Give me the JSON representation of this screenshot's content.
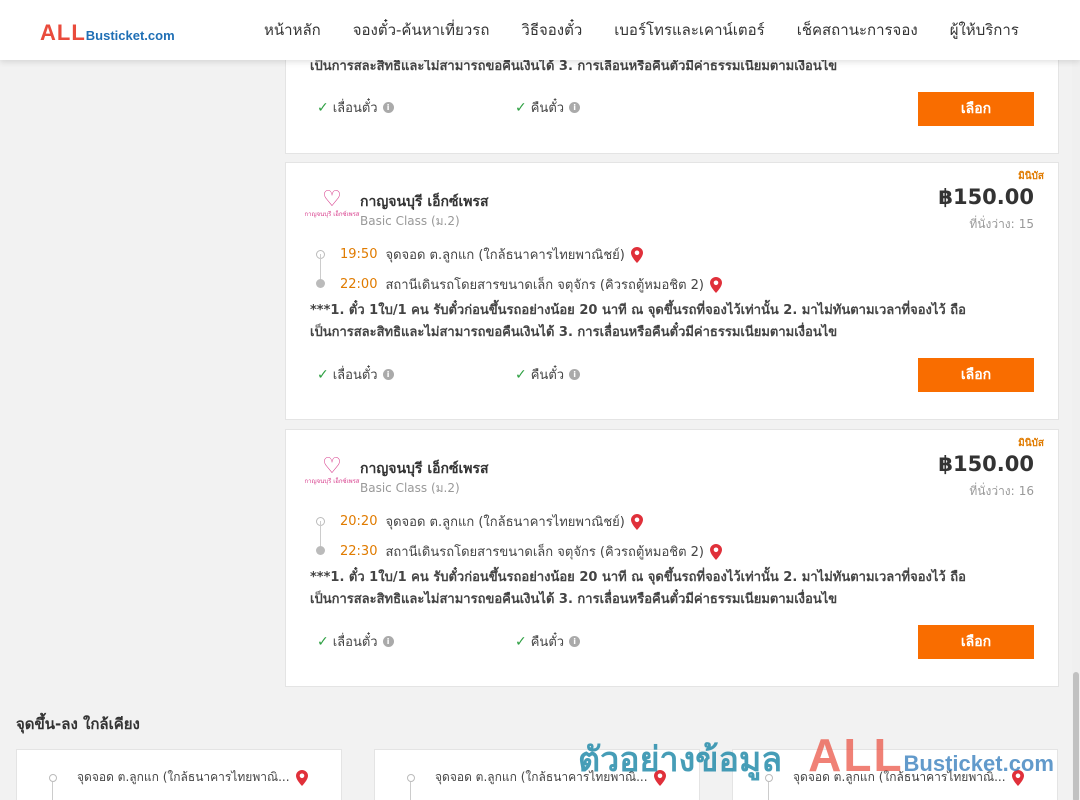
{
  "logo": {
    "all": "ALL",
    "rest": "Busticket.com"
  },
  "nav": [
    "หน้าหลัก",
    "จองตั๋ว-ค้นหาเที่ยวรถ",
    "วิธีจองตั๋ว",
    "เบอร์โทรและเคาน์เตอร์",
    "เช็คสถานะการจอง",
    "ผู้ให้บริการ"
  ],
  "top_card": {
    "condition_line2": "เป็นการสละสิทธิและไม่สามารถขอคืนเงินได้ 3. การเลื่อนหรือคืนตั๋วมีค่าธรรมเนียมตามเงื่อนไข",
    "change_label": "เลื่อนตั๋ว",
    "refund_label": "คืนตั๋ว",
    "select_label": "เลือก"
  },
  "trips": [
    {
      "badge": "มินิบัส",
      "logo_text": "กาญจนบุรี เอ็กซ์เพรส",
      "operator": "กาญจนบุรี เอ็กซ์เพรส",
      "class": "Basic Class (ม.2)",
      "price": "฿150.00",
      "seats_label": "ที่นั่งว่าง:",
      "seats": "15",
      "depart_time": "19:50",
      "depart_place": "จุดจอด ต.ลูกแก (ใกล้ธนาคารไทยพาณิชย์)",
      "arrive_time": "22:00",
      "arrive_place": "สถานีเดินรถโดยสารขนาดเล็ก จตุจักร (คิวรถตู้หมอชิต 2)",
      "condition_line1": "***1. ตั๋ว 1ใบ/1 คน รับตั๋วก่อนขึ้นรถอย่างน้อย 20 นาที ณ จุดขึ้นรถที่จองไว้เท่านั้น 2. มาไม่ทันตามเวลาที่จองไว้ ถือ",
      "condition_line2": "เป็นการสละสิทธิและไม่สามารถขอคืนเงินได้ 3. การเลื่อนหรือคืนตั๋วมีค่าธรรมเนียมตามเงื่อนไข",
      "change_label": "เลื่อนตั๋ว",
      "refund_label": "คืนตั๋ว",
      "select_label": "เลือก"
    },
    {
      "badge": "มินิบัส",
      "logo_text": "กาญจนบุรี เอ็กซ์เพรส",
      "operator": "กาญจนบุรี เอ็กซ์เพรส",
      "class": "Basic Class (ม.2)",
      "price": "฿150.00",
      "seats_label": "ที่นั่งว่าง:",
      "seats": "16",
      "depart_time": "20:20",
      "depart_place": "จุดจอด ต.ลูกแก (ใกล้ธนาคารไทยพาณิชย์)",
      "arrive_time": "22:30",
      "arrive_place": "สถานีเดินรถโดยสารขนาดเล็ก จตุจักร (คิวรถตู้หมอชิต 2)",
      "condition_line1": "***1. ตั๋ว 1ใบ/1 คน รับตั๋วก่อนขึ้นรถอย่างน้อย 20 นาที ณ จุดขึ้นรถที่จองไว้เท่านั้น 2. มาไม่ทันตามเวลาที่จองไว้ ถือ",
      "condition_line2": "เป็นการสละสิทธิและไม่สามารถขอคืนเงินได้ 3. การเลื่อนหรือคืนตั๋วมีค่าธรรมเนียมตามเงื่อนไข",
      "change_label": "เลื่อนตั๋ว",
      "refund_label": "คืนตั๋ว",
      "select_label": "เลือก"
    }
  ],
  "nearby": {
    "title": "จุดขึ้น-ลง ใกล้เคียง",
    "items": [
      "จุดจอด ต.ลูกแก (ใกล้ธนาคารไทยพาณิ...",
      "จุดจอด ต.ลูกแก (ใกล้ธนาคารไทยพาณิ...",
      "จุดจอด ต.ลูกแก (ใกล้ธนาคารไทยพาณิ..."
    ]
  },
  "watermark": {
    "text": "ตัวอย่างข้อมูล",
    "all": "ALL",
    "rest": "Busticket.com"
  },
  "colors": {
    "accent": "#f96d00",
    "time": "#e07b00",
    "check": "#2ea043",
    "pin": "#e0303a",
    "brand_red": "#e94b3c",
    "brand_blue": "#1f6fb5"
  },
  "icons": {
    "check": "check-icon",
    "info": "info-icon",
    "pin": "map-pin-icon",
    "logo": "heart-logo-icon"
  }
}
